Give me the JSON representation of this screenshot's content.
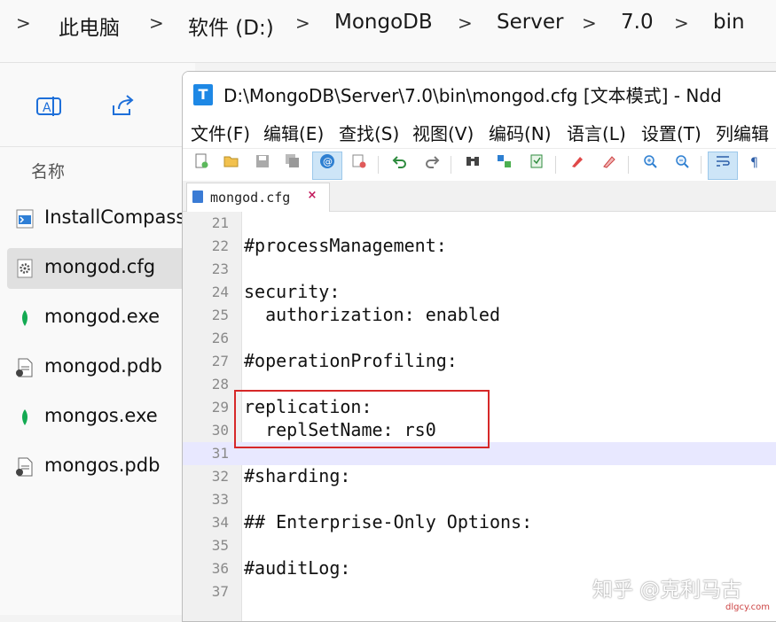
{
  "breadcrumb": {
    "items": [
      "此电脑",
      "软件 (D:)",
      "MongoDB",
      "Server",
      "7.0",
      "bin"
    ],
    "separator": ">"
  },
  "explorer": {
    "toolbar_icons": [
      "ocr-text-icon",
      "share-icon"
    ],
    "column_header": "名称",
    "files": [
      {
        "name": "InstallCompass.",
        "icon": "powershell-script-icon",
        "selected": false
      },
      {
        "name": "mongod.cfg",
        "icon": "config-file-icon",
        "selected": true
      },
      {
        "name": "mongod.exe",
        "icon": "mongodb-leaf-icon",
        "selected": false
      },
      {
        "name": "mongod.pdb",
        "icon": "pdb-file-icon",
        "selected": false
      },
      {
        "name": "mongos.exe",
        "icon": "mongodb-leaf-icon",
        "selected": false
      },
      {
        "name": "mongos.pdb",
        "icon": "pdb-file-icon",
        "selected": false
      }
    ]
  },
  "ndd": {
    "title": "D:\\MongoDB\\Server\\7.0\\bin\\mongod.cfg [文本模式] - Ndd",
    "app_icon_letter": "T",
    "menu": [
      "文件(F)",
      "编辑(E)",
      "查找(S)",
      "视图(V)",
      "编码(N)",
      "语言(L)",
      "设置(T)",
      "列编辑"
    ],
    "toolbar": [
      "new",
      "open",
      "save",
      "save-all",
      "file-watch",
      "close",
      "undo",
      "redo",
      "find",
      "replace",
      "bookmark",
      "marker",
      "clear-marker",
      "zoom-in",
      "zoom-out",
      "word-wrap",
      "show-symbols"
    ],
    "tab": {
      "label": "mongod.cfg",
      "close": "×"
    },
    "lines": [
      {
        "n": "21",
        "text": ""
      },
      {
        "n": "22",
        "text": "#processManagement:"
      },
      {
        "n": "23",
        "text": ""
      },
      {
        "n": "24",
        "text": "security:"
      },
      {
        "n": "25",
        "text": "  authorization: enabled"
      },
      {
        "n": "26",
        "text": ""
      },
      {
        "n": "27",
        "text": "#operationProfiling:"
      },
      {
        "n": "28",
        "text": ""
      },
      {
        "n": "29",
        "text": "replication:"
      },
      {
        "n": "30",
        "text": "  replSetName: rs0"
      },
      {
        "n": "31",
        "text": "",
        "current": true
      },
      {
        "n": "32",
        "text": "#sharding:"
      },
      {
        "n": "33",
        "text": ""
      },
      {
        "n": "34",
        "text": "## Enterprise-Only Options:"
      },
      {
        "n": "35",
        "text": ""
      },
      {
        "n": "36",
        "text": "#auditLog:"
      },
      {
        "n": "37",
        "text": ""
      }
    ]
  },
  "watermark": "知乎 @克利马古",
  "site_mark": "dlgcy.com",
  "colors": {
    "highlight_border": "#d62828",
    "current_line": "#e8e8ff",
    "selected_file": "#e0e0e0"
  }
}
